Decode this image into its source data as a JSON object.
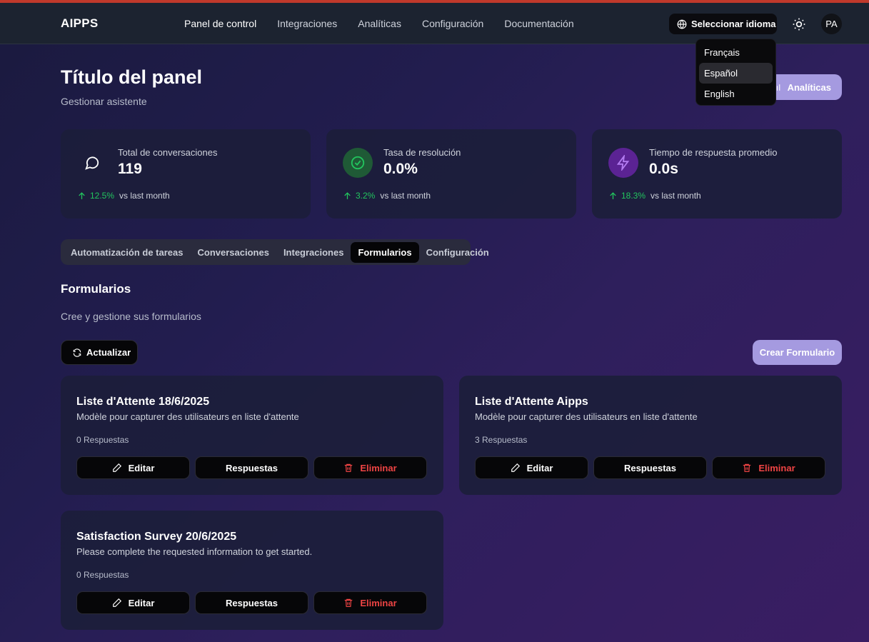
{
  "header": {
    "logo": "AIPPS",
    "nav": [
      "Panel de control",
      "Integraciones",
      "Analíticas",
      "Configuración",
      "Documentación"
    ],
    "language_button": "Seleccionar idioma",
    "avatar": "PA"
  },
  "language_menu": [
    "Français",
    "Español",
    "English"
  ],
  "page": {
    "title": "Título del panel",
    "subtitle": "Gestionar asistente",
    "analytics_button": "Analíticas"
  },
  "stats": [
    {
      "label": "Total de conversaciones",
      "value": "119",
      "trend": "12.5%",
      "trend_text": "vs last month",
      "icon": "chat-icon",
      "icon_bg": "transparent",
      "icon_color": "#ffffff"
    },
    {
      "label": "Tasa de resolución",
      "value": "0.0%",
      "trend": "3.2%",
      "trend_text": "vs last month",
      "icon": "check-circle-icon",
      "icon_bg": "#1f5a36",
      "icon_color": "#22c55e"
    },
    {
      "label": "Tiempo de respuesta promedio",
      "value": "0.0s",
      "trend": "18.3%",
      "trend_text": "vs last month",
      "icon": "lightning-icon",
      "icon_bg": "#5b2394",
      "icon_color": "#b47cf2"
    }
  ],
  "tabs": [
    "Automatización de tareas",
    "Conversaciones",
    "Integraciones",
    "Formularios",
    "Configuración"
  ],
  "section": {
    "title": "Formularios",
    "subtitle": "Cree y gestione sus formularios",
    "refresh_button": "Actualizar",
    "create_button": "Crear Formulario"
  },
  "forms": [
    {
      "title": "Liste d'Attente 18/6/2025",
      "description": "Modèle pour capturer des utilisateurs en liste d'attente",
      "responses": "0 Respuestas"
    },
    {
      "title": "Liste d'Attente Aipps",
      "description": "Modèle pour capturer des utilisateurs en liste d'attente",
      "responses": "3 Respuestas"
    },
    {
      "title": "Satisfaction Survey 20/6/2025",
      "description": "Please complete the requested information to get started.",
      "responses": "0 Respuestas"
    }
  ],
  "form_actions": {
    "edit": "Editar",
    "responses": "Respuestas",
    "delete": "Eliminar"
  },
  "colors": {
    "accent": "#a59ae0",
    "success": "#22c55e",
    "danger": "#ef4444"
  }
}
